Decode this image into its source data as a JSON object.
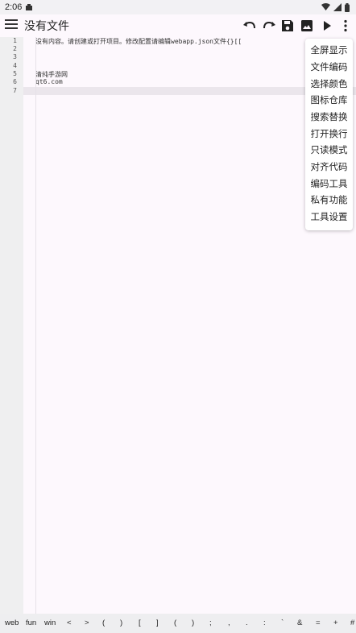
{
  "status_bar": {
    "time": "2:06"
  },
  "app_bar": {
    "title": "没有文件",
    "icons": [
      "menu-icon",
      "undo-icon",
      "redo-icon",
      "save-icon",
      "image-icon",
      "run-icon",
      "more-vert-icon"
    ]
  },
  "editor": {
    "line_numbers": [
      "1",
      "2",
      "3",
      "4",
      "5",
      "6",
      "7"
    ],
    "lines": [
      "没有内容。请创建或打开项目。修改配置请编辑webapp.json文件{}[[",
      "",
      "",
      "",
      "清纯手游网",
      "qt6.com",
      ""
    ],
    "current_line": 7
  },
  "popup_menu": {
    "items": [
      "全屏显示",
      "文件编码",
      "选择颜色",
      "图标仓库",
      "搜索替换",
      "打开换行",
      "只读模式",
      "对齐代码",
      "编码工具",
      "私有功能",
      "工具设置"
    ]
  },
  "symbol_bar": {
    "keys": [
      "web",
      "fun",
      "win",
      "<",
      ">",
      "(",
      ")",
      "[",
      "]",
      "(",
      ")",
      ";",
      ",",
      ".",
      ":",
      "`",
      "&",
      "=",
      "+",
      "#"
    ]
  },
  "colors": {
    "background": "#fdf8fd",
    "gutter": "#efeff0",
    "current_line": "#ebe6ec",
    "menu_background": "#ffffff"
  }
}
